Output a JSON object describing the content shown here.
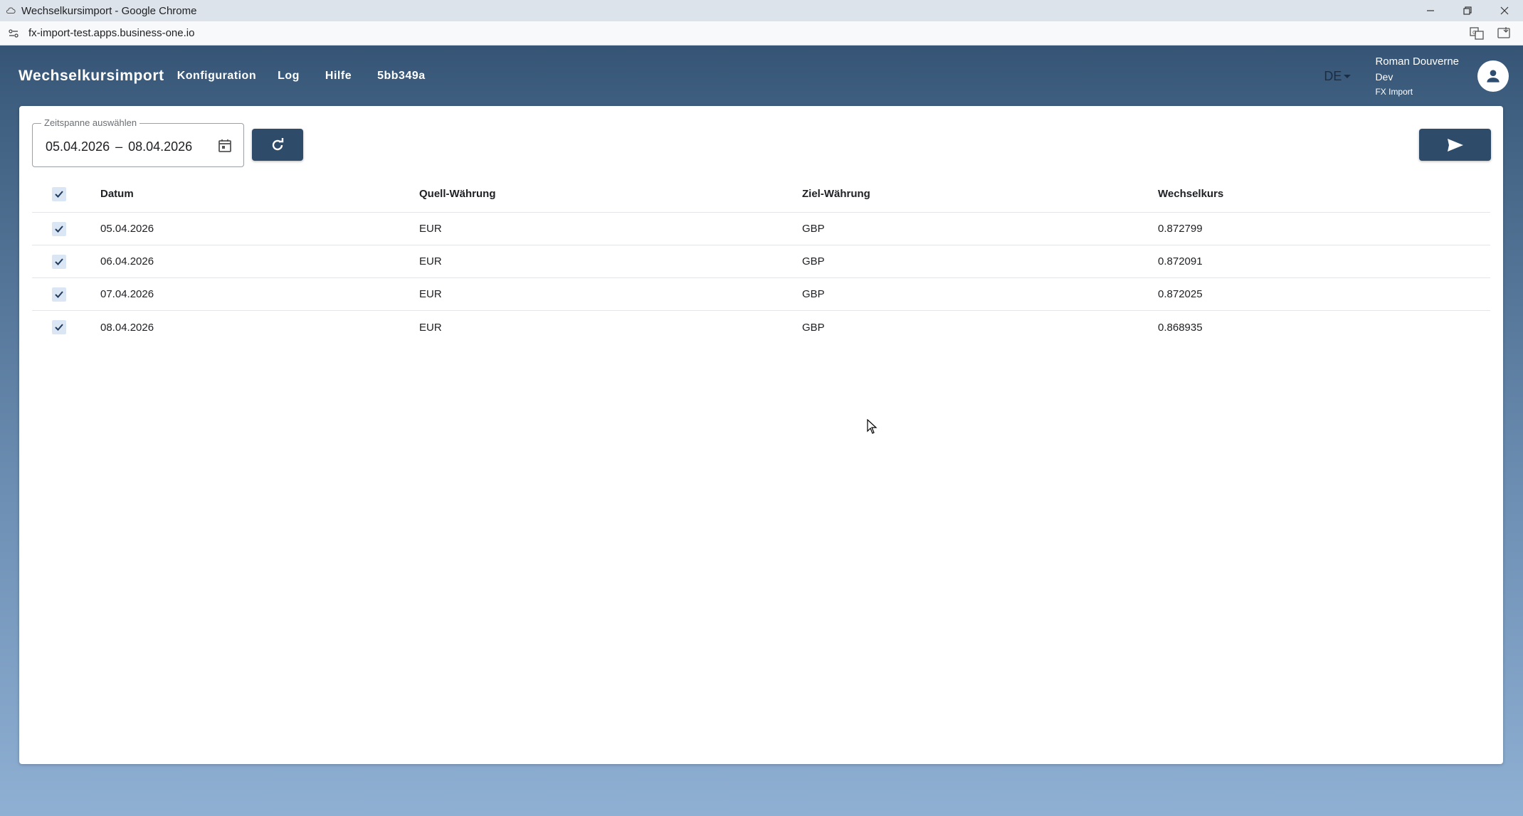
{
  "browser": {
    "window_title": "Wechselkursimport - Google Chrome",
    "url": "fx-import-test.apps.business-one.io"
  },
  "app": {
    "brand": "Wechselkursimport",
    "nav": [
      "Konfiguration",
      "Log",
      "Hilfe",
      "5bb349a"
    ],
    "language": "DE",
    "user": {
      "name": "Roman Douverne",
      "role": "Dev",
      "app": "FX Import"
    }
  },
  "filter": {
    "label": "Zeitspanne auswählen",
    "start": "05.04.2026",
    "separator": "–",
    "end": "08.04.2026"
  },
  "table": {
    "columns": [
      "Datum",
      "Quell-Währung",
      "Ziel-Währung",
      "Wechselkurs"
    ],
    "rows": [
      {
        "date": "05.04.2026",
        "source": "EUR",
        "target": "GBP",
        "rate": "0.872799"
      },
      {
        "date": "06.04.2026",
        "source": "EUR",
        "target": "GBP",
        "rate": "0.872091"
      },
      {
        "date": "07.04.2026",
        "source": "EUR",
        "target": "GBP",
        "rate": "0.872025"
      },
      {
        "date": "08.04.2026",
        "source": "EUR",
        "target": "GBP",
        "rate": "0.868935"
      }
    ]
  },
  "colors": {
    "header": "#2f4d6e",
    "button": "#2f4b6a",
    "checkbox": "#dbe6f5"
  }
}
